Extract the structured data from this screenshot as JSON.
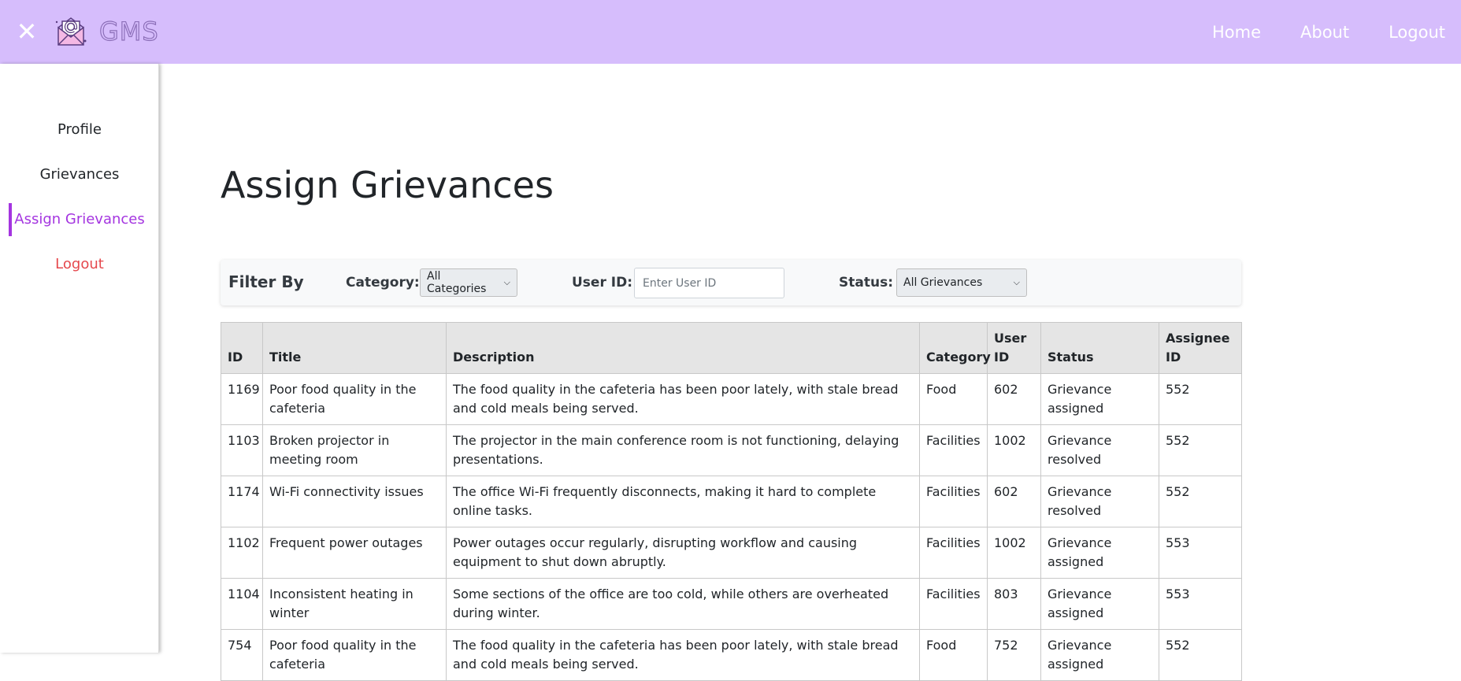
{
  "navbar": {
    "close_glyph": "✕",
    "brand": "GMS",
    "logo_icon": "envelope-at-icon",
    "links": [
      "Home",
      "About",
      "Logout"
    ]
  },
  "sidebar": {
    "items": [
      {
        "label": "Profile"
      },
      {
        "label": "Grievances"
      },
      {
        "label": "Assign Grievances",
        "active": true
      },
      {
        "label": "Logout"
      }
    ]
  },
  "page": {
    "title": "Assign Grievances"
  },
  "filter": {
    "title": "Filter By",
    "category_label": "Category:",
    "category_value": "All Categories",
    "userid_label": "User ID:",
    "userid_placeholder": "Enter User ID",
    "status_label": "Status:",
    "status_value": "All Grievances"
  },
  "table": {
    "headers": [
      "ID",
      "Title",
      "Description",
      "Category",
      "User ID",
      "Status",
      "Assignee ID"
    ],
    "rows": [
      [
        "1169",
        "Poor food quality in the cafeteria",
        "The food quality in the cafeteria has been poor lately, with stale bread and cold meals being served.",
        "Food",
        "602",
        "Grievance assigned",
        "552"
      ],
      [
        "1103",
        "Broken projector in meeting room",
        "The projector in the main conference room is not functioning, delaying presentations.",
        "Facilities",
        "1002",
        "Grievance resolved",
        "552"
      ],
      [
        "1174",
        "Wi-Fi connectivity issues",
        "The office Wi-Fi frequently disconnects, making it hard to complete online tasks.",
        "Facilities",
        "602",
        "Grievance resolved",
        "552"
      ],
      [
        "1102",
        "Frequent power outages",
        "Power outages occur regularly, disrupting workflow and causing equipment to shut down abruptly.",
        "Facilities",
        "1002",
        "Grievance assigned",
        "553"
      ],
      [
        "1104",
        "Inconsistent heating in winter",
        "Some sections of the office are too cold, while others are overheated during winter.",
        "Facilities",
        "803",
        "Grievance assigned",
        "553"
      ],
      [
        "754",
        "Poor food quality in the cafeteria",
        "The food quality in the cafeteria has been poor lately, with stale bread and cold meals being served.",
        "Food",
        "752",
        "Grievance assigned",
        "552"
      ]
    ]
  },
  "colors": {
    "navbar": "#d6bdfc",
    "accent": "#a435e0",
    "logout": "#e5484d"
  }
}
